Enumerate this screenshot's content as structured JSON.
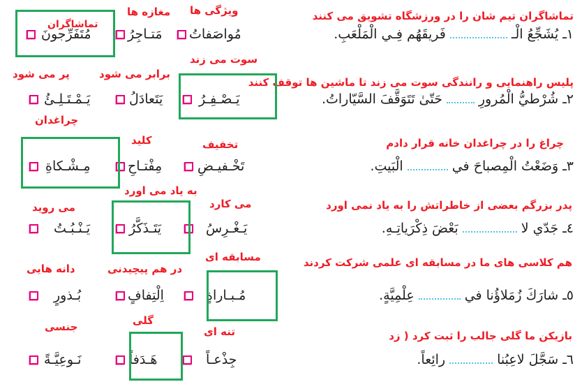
{
  "colors": {
    "translation_red": "#ee1c25",
    "answer_box_green": "#22a75a",
    "checkbox_magenta": "#e6007e",
    "blank_dots_blue": "#4fc3e8",
    "text_black": "#231f20"
  },
  "questions": [
    {
      "number": "١",
      "translation": "تماشاگران تیم شان را در ورزشگاه تشویق می کنند",
      "sentence_before": "١ـ يُشَجِّعُ الْـ",
      "sentence_after": "فَريقَهُم فِـي الْمَلْعَبِ.",
      "options": [
        {
          "word": "مُواصَفاتُ",
          "gloss": "ویژگی ها",
          "selected": false
        },
        {
          "word": "مَتـاجِرُ",
          "gloss": "مغازه ها",
          "selected": false
        },
        {
          "word": "مُتَفَرِّجونَ",
          "gloss": "تماشاگران",
          "selected": true
        }
      ]
    },
    {
      "number": "٢",
      "translation": "پلیس راهنمایی و رانندگی سوت می زند تا ماشین ها توقف کنند",
      "sentence_before": "٢ـ شُرْطيُّ الْمُرورِ",
      "sentence_after": "حَتّىٰ تَتَوَقَّفَ السَّيّاراتُ.",
      "options": [
        {
          "word": "يَـصْـفِـرُ",
          "gloss": "سوت می زند",
          "selected": true
        },
        {
          "word": "يَتَعادَلُ",
          "gloss": "برابر می شود",
          "selected": false
        },
        {
          "word": "يَـمْـتَـلِـئُ",
          "gloss": "پر می شود",
          "selected": false
        }
      ]
    },
    {
      "number": "٣",
      "translation": "چراغ را  در چراغدان خانه قرار دادم",
      "sentence_before": "٣ـ وَضَعْتُ الْمِصباحَ في",
      "sentence_after": "الْبَيتِ.",
      "options": [
        {
          "word": "تَخْـفيـضِ",
          "gloss": "تخفیف",
          "selected": false
        },
        {
          "word": "مِفْتـاحِ",
          "gloss": "کلید",
          "selected": false
        },
        {
          "word": "مِـشْـكاةِ",
          "gloss": "چراغدان",
          "selected": true
        }
      ]
    },
    {
      "number": "٤",
      "translation": "پدر بزرگم بعضی از خاطراتش  را به یاد نمی اورد",
      "sentence_before": "٤ـ جَدّي لا",
      "sentence_after": "بَعْضَ ذِكْرَياتِـهِ.",
      "options": [
        {
          "word": "يَـغْـرِسُ",
          "gloss": "می کارد",
          "selected": false
        },
        {
          "word": "يَتَـذَكَّرُ",
          "gloss": "به یاد می اورد",
          "selected": true
        },
        {
          "word": "يَـنْـبُـتُ",
          "gloss": "می روید",
          "selected": false
        }
      ]
    },
    {
      "number": "٥",
      "translation": "هم کلاسی های ما در مسابقه ای علمی شرکت کردند",
      "sentence_before": "٥ـ شارَكَ زُمَلاؤُنا في",
      "sentence_after": "عِلْمِيَّةٍ.",
      "options": [
        {
          "word": "مُـبـاراةٍ",
          "gloss": "مسابقه ای",
          "selected": true
        },
        {
          "word": "اِلْتِفافٍ",
          "gloss": "در هم پیچیدنی",
          "selected": false
        },
        {
          "word": "بُـذورٍ",
          "gloss": "دانه هایی",
          "selected": false
        }
      ]
    },
    {
      "number": "٦",
      "translation": "بازیکن ما گلی جالب را ثبت کرد ( زد",
      "sentence_before": "٦ـ سَجَّلَ لاعِبُنا",
      "sentence_after": "رائِعاً.",
      "options": [
        {
          "word": "جِذْعـاً",
          "gloss": "تنه ای",
          "selected": false
        },
        {
          "word": "هَـدَفاً",
          "gloss": "گلی",
          "selected": true
        },
        {
          "word": "نَـوعِيَّـةً",
          "gloss": "جنسی",
          "selected": false
        }
      ]
    }
  ]
}
